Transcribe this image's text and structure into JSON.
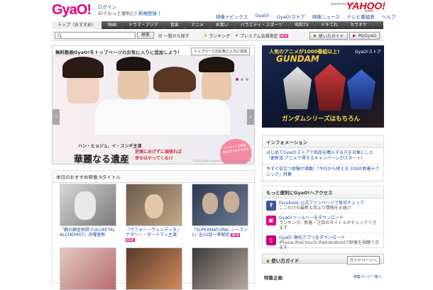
{
  "header": {
    "logo": "GyaO!",
    "login": "ログイン",
    "login_sub_prefix": "IDでもっと便利に",
    "register": "[ 新規登録 ]",
    "presented_by": "presented by",
    "yahoo": "YAHOO!",
    "yahoo_japan": "JAPAN",
    "top_links": [
      "映像トピックス",
      "GyaO!",
      "GyaO!ストア",
      "映像ニュース",
      "テレビ番組表",
      "ヘルプ"
    ]
  },
  "nav": {
    "tabs": [
      "トップ（おすすめ）",
      "映画",
      "ドラマ・アジア",
      "音楽",
      "アニメ",
      "お笑い",
      "バラエティ・スポーツ",
      "昭和TV",
      "ドキてれ",
      "カラオケ"
    ],
    "active": 0
  },
  "search": {
    "placeholder": "",
    "button": "検索",
    "list_link": "一覧から探す",
    "ranking": "ランキング",
    "premium": "プレミアム会員限定",
    "new_badge": "NEW",
    "guide_button": "使い方ガイド",
    "mygyao_button": "MyGyaO"
  },
  "banner": {
    "title": "無料動画GyaO!をトップページのお気に入りに追加しよう！",
    "favorite_button": "トップページのお気に入りに追加",
    "subtitle": "ハン・ヒョジュ、イ・スンギ主演",
    "main_title": "華麗なる遺産",
    "tagline_1": "逆境にめげずに頑張れば",
    "tagline_2": "幸せはやってくる!?",
    "heart_1": "ノーカット字幕版",
    "heart_2": "最新2月1日まで配信",
    "copyright": "©SBS & SBS Contents Hub. All rights reserved.",
    "prev": "‹",
    "next": "›"
  },
  "recommend": {
    "header": "本日のおすすめ映像 9タイトル",
    "items": [
      {
        "caption": "『鋼の錬金術師 FULLMETAL ALCHEMIST』月曜更新",
        "new": ""
      },
      {
        "caption": "『ヴフォー・ヴェンデッタ』ナタリー・ポートマン主演",
        "new": "NEW"
      },
      {
        "caption": "「SUPERNATURAL シーズン1」全22話一挙配信",
        "new": "NEW"
      },
      {
        "caption": "",
        "new": ""
      },
      {
        "caption": "",
        "new": ""
      },
      {
        "caption": "",
        "new": ""
      }
    ]
  },
  "ad": {
    "headline": "人気のアニメが1000番組以上!",
    "store": "GyaO!ストア",
    "series": "ガンダムシリーズはもちろん"
  },
  "info": {
    "header": "インフォメーション",
    "items": [
      "はじめてGyaO!ストアで商品を購入する方を対象にした「更新済 アニメで得するキャンペーンがスタート!",
      "今すぐ役立つ体験が満載!「今日から使える 100の新着テクニック」特集"
    ]
  },
  "more": {
    "header": "もっと便利にGyaO!へアクセス",
    "items": [
      {
        "title": "Facebook 公式ファンページで毎日チェック",
        "sub": "ここだけの最新＆耳より情報をお届け"
      },
      {
        "title": "GyaO!ツールバーをダウンロード",
        "sub": "ランキング、新着・注目のタイトルがチェックできます"
      },
      {
        "title": "GyaO! 無料アプリをダウンロード",
        "sub": "iPhone,iPod touch,iPad,Androidで映像を視聴できます"
      }
    ]
  },
  "guide": {
    "label": "使い方ガイド",
    "button": "ガイドページへ"
  },
  "special": {
    "label": "特集企画",
    "link": "特集ページ一覧へ"
  },
  "colors": {
    "brand_pink": "#e4007f",
    "yahoo_red": "#d7001c",
    "link_blue": "#1a4aa6",
    "nav_dark": "#333333"
  }
}
